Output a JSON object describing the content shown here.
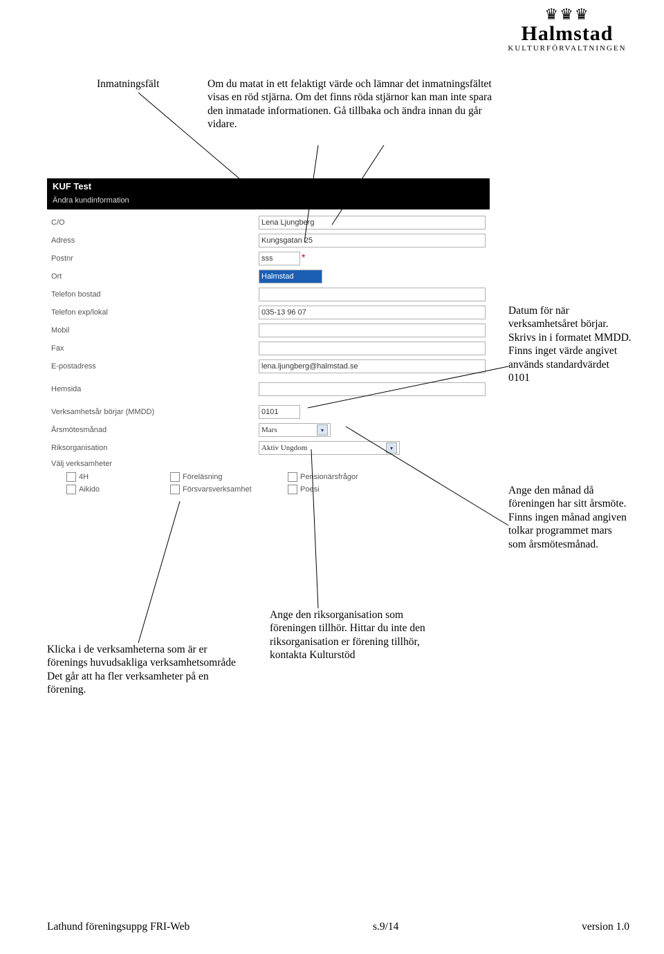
{
  "logo": {
    "name": "Halmstad",
    "sub": "KULTURFÖRVALTNINGEN"
  },
  "annotations": {
    "inmat_label": "Inmatningsfält",
    "top_para": "Om du matat in ett felaktigt värde och lämnar det inmatningsfältet visas en röd stjärna. Om det finns röda stjärnor kan man inte spara den inmatade informationen. Gå tillbaka och ändra innan du går vidare.",
    "datum": "Datum för när verksamhetsåret börjar. Skrivs in i formatet MMDD. Finns inget värde angivet används standardvärdet 0101",
    "arsmote": "Ange den månad då föreningen har sitt årsmöte. Finns ingen månad angiven tolkar programmet mars som årsmötesmånad.",
    "riksorg": "Ange den riksorganisation som föreningen tillhör. Hittar du inte den riksorganisation er förening tillhör, kontakta Kulturstöd",
    "verks": "Klicka i de verksamheterna som är er förenings huvudsakliga verksamhetsområde Det går att ha fler verksamheter på en förening."
  },
  "screenshot": {
    "title": "KUF Test",
    "subtitle": "Ändra kundinformation",
    "labels": {
      "co": "C/O",
      "adress": "Adress",
      "postnr": "Postnr",
      "ort": "Ort",
      "tel_bostad": "Telefon bostad",
      "tel_explokal": "Telefon exp/lokal",
      "mobil": "Mobil",
      "fax": "Fax",
      "epost": "E-postadress",
      "hemsida": "Hemsida",
      "verksar": "Verksamhetsår börjar (MMDD)",
      "arsmotesmanad": "Årsmötesmånad",
      "riksorg": "Riksorganisation",
      "valj_verks": "Välj verksamheter"
    },
    "values": {
      "co": "Lena Ljungberg",
      "adress": "Kungsgatan 25",
      "postnr": "sss",
      "ort": "Halmstad",
      "tel_bostad": "",
      "tel_explokal": "035-13 96 07",
      "mobil": "",
      "fax": "",
      "epost": "lena.ljungberg@halmstad.se",
      "hemsida": "",
      "verksar": "0101",
      "arsmotesmanad": "Mars",
      "riksorg": "Aktiv Ungdom"
    },
    "checkboxes": {
      "r1c1": "4H",
      "r1c2": "Föreläsning",
      "r1c3": "Pensionärsfrågor",
      "r2c1": "Aikido",
      "r2c2": "Försvarsverksamhet",
      "r2c3": "Poesi"
    }
  },
  "footer": {
    "left": "Lathund föreningsuppg FRI-Web",
    "mid": "s.9/14",
    "right": "version 1.0"
  }
}
